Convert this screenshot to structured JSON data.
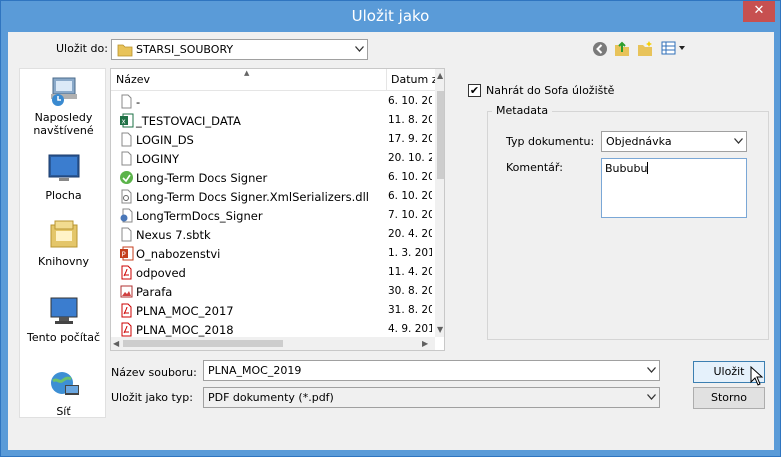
{
  "window": {
    "title": "Uložit jako",
    "close_glyph": "✕"
  },
  "save_in": {
    "label": "Uložit do:",
    "value": "STARSI_SOUBORY"
  },
  "toolbar": {
    "icons": [
      "back-icon",
      "up-folder-icon",
      "new-folder-icon",
      "view-menu-icon"
    ]
  },
  "places": [
    {
      "name": "places-recent",
      "icon": "recent-places-icon",
      "label": "Naposledy navštívené"
    },
    {
      "name": "places-desktop",
      "icon": "desktop-icon",
      "label": "Plocha"
    },
    {
      "name": "places-libraries",
      "icon": "libraries-icon",
      "label": "Knihovny"
    },
    {
      "name": "places-this-pc",
      "icon": "computer-icon",
      "label": "Tento počítač"
    },
    {
      "name": "places-network",
      "icon": "network-icon",
      "label": "Síť"
    }
  ],
  "file_list": {
    "columns": [
      "Název",
      "Datum z"
    ],
    "rows": [
      {
        "name": "-",
        "date": "6. 10. 20",
        "icon": "file-icon"
      },
      {
        "name": "_TESTOVACI_DATA",
        "date": "11. 8. 20",
        "icon": "excel-icon"
      },
      {
        "name": "LOGIN_DS",
        "date": "17. 9. 20",
        "icon": "file-icon"
      },
      {
        "name": "LOGINY",
        "date": "20. 10. 2",
        "icon": "file-icon"
      },
      {
        "name": "Long-Term Docs Signer",
        "date": "6. 10. 20",
        "icon": "app-icon"
      },
      {
        "name": "Long-Term Docs Signer.XmlSerializers.dll",
        "date": "6. 10. 20",
        "icon": "dll-icon"
      },
      {
        "name": "LongTermDocs_Signer",
        "date": "7. 10. 20",
        "icon": "config-icon"
      },
      {
        "name": "Nexus 7.sbtk",
        "date": "20. 4. 20",
        "icon": "file-icon"
      },
      {
        "name": "O_nabozenstvi",
        "date": "1. 3. 201",
        "icon": "powerpoint-icon"
      },
      {
        "name": "odpoved",
        "date": "11. 4. 20",
        "icon": "pdf-icon"
      },
      {
        "name": "Parafa",
        "date": "30. 8. 20",
        "icon": "image-icon"
      },
      {
        "name": "PLNA_MOC_2017",
        "date": "31. 8. 20",
        "icon": "pdf-icon"
      },
      {
        "name": "PLNA_MOC_2018",
        "date": "4. 9. 201",
        "icon": "pdf-icon"
      }
    ]
  },
  "upload_option": {
    "label": "Nahrát do Sofa úložiště",
    "checked": true,
    "check_glyph": "✔"
  },
  "metadata": {
    "legend": "Metadata",
    "doc_type_label": "Typ dokumentu:",
    "doc_type_value": "Objednávka",
    "comment_label": "Komentář:",
    "comment_value": "Bububu"
  },
  "filename": {
    "label": "Název souboru:",
    "value": "PLNA_MOC_2019"
  },
  "filetype": {
    "label": "Uložit jako typ:",
    "value": "PDF dokumenty (*.pdf)"
  },
  "buttons": {
    "save": "Uložit",
    "cancel": "Storno"
  },
  "colors": {
    "titlebar": "#5a9bd8",
    "close": "#c75050",
    "dialog_bg": "#f0f0f0"
  }
}
